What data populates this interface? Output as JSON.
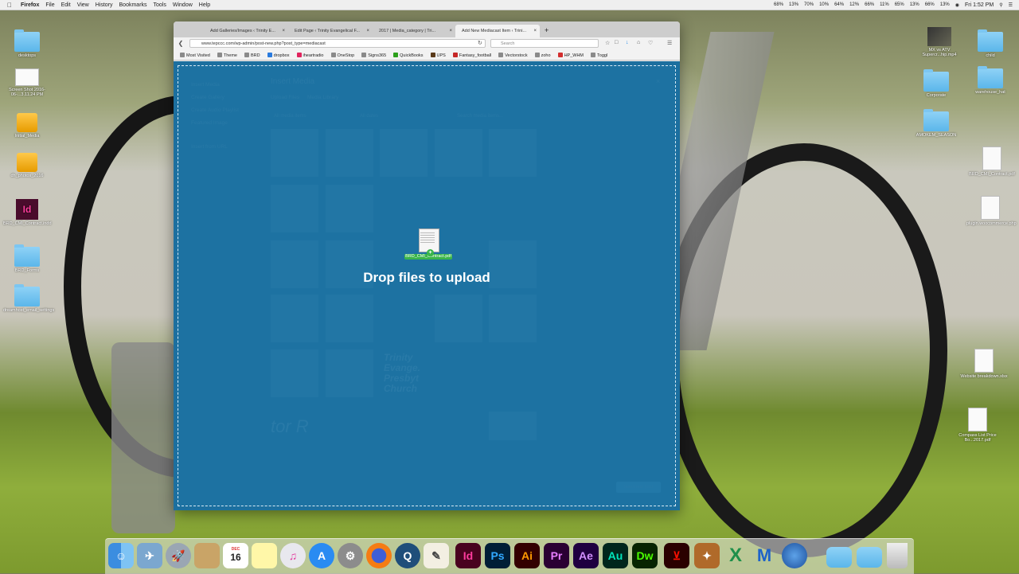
{
  "menubar": {
    "app": "Firefox",
    "items": [
      "File",
      "Edit",
      "View",
      "History",
      "Bookmarks",
      "Tools",
      "Window",
      "Help"
    ],
    "status": [
      "68%",
      "13%",
      "70%",
      "10%",
      "64%",
      "12%",
      "66%",
      "11%",
      "65%",
      "13%",
      "66%",
      "13%"
    ],
    "clock": "Fri 1:52 PM"
  },
  "desktop_left": [
    {
      "label": "desktops"
    },
    {
      "label": "Screen Shot 2016-06-...3.11.24 PM"
    },
    {
      "label": "Initial_Media"
    },
    {
      "label": "dh_photos_2016"
    },
    {
      "label": "BRD_CMI_Contract.indd"
    },
    {
      "label": "BRD_Forms"
    },
    {
      "label": "dreamhost_email_settings"
    }
  ],
  "desktop_right": [
    {
      "label": "MX vs ATV Supercr...hip.mp4"
    },
    {
      "label": "child"
    },
    {
      "label": "Corporate"
    },
    {
      "label": "warehouse_hat"
    },
    {
      "label": "AMOKEM_SEASON"
    },
    {
      "label": "BRD_CMI_Contract.pdf"
    },
    {
      "label": "plugin.woocommerce.php"
    },
    {
      "label": "Website breakdown.xlsx"
    },
    {
      "label": "Compass List Price Bo...2017.pdf"
    }
  ],
  "browser": {
    "tabs": [
      {
        "label": "Add Galleries/Images ‹ Trinity E..."
      },
      {
        "label": "Edit Page ‹ Trinity Evangelical F..."
      },
      {
        "label": "2017 | Media_category | Tri..."
      },
      {
        "label": "Add New Mediacast Item ‹ Trini..."
      }
    ],
    "url": "www.tepccc.com/wp-admin/post-new.php?post_type=mediacast",
    "search_placeholder": "Search",
    "bookmarks": [
      "Most Visited",
      "Theme",
      "BRD",
      "dropbox",
      "iheartradio",
      "OneStop",
      "Signs365",
      "QuickBooks",
      "UPS",
      "Fantasy_football",
      "Vectorstock",
      "zoho",
      "HP_WHM",
      "Toggl"
    ]
  },
  "media_modal": {
    "title": "Insert Media",
    "side_menu": [
      "Insert Media",
      "Create Gallery",
      "Create Audio Playlist",
      "Featured Image",
      "Insert from URL"
    ],
    "tabs": [
      "Upload Files",
      "Media Library"
    ],
    "filter_type": "All media items",
    "filter_date": "All dates",
    "search_placeholder": "Search media items...",
    "insert_button": "Insert into post",
    "drop_text": "Drop files to upload",
    "dragged_file": "BRD_CMI_Contract.pdf",
    "thumb_texts": [
      "Trinity Evange. Presbyt Church",
      "tor R"
    ]
  },
  "dock": {
    "apps": [
      "Finder",
      "Preview",
      "Launchpad",
      "Notes",
      "Calendar",
      "Stickies",
      "iTunes",
      "App Store",
      "System Preferences",
      "Firefox",
      "QuickTime",
      "TextEdit",
      "InDesign",
      "Photoshop",
      "Illustrator",
      "Premiere",
      "After Effects",
      "Audition",
      "Dreamweaver",
      "Acrobat",
      "Fiddler",
      "Excel",
      "Maven",
      "Google Earth",
      "Downloads",
      "Documents",
      "Trash"
    ],
    "calendar_month": "DEC",
    "calendar_day": "16"
  }
}
